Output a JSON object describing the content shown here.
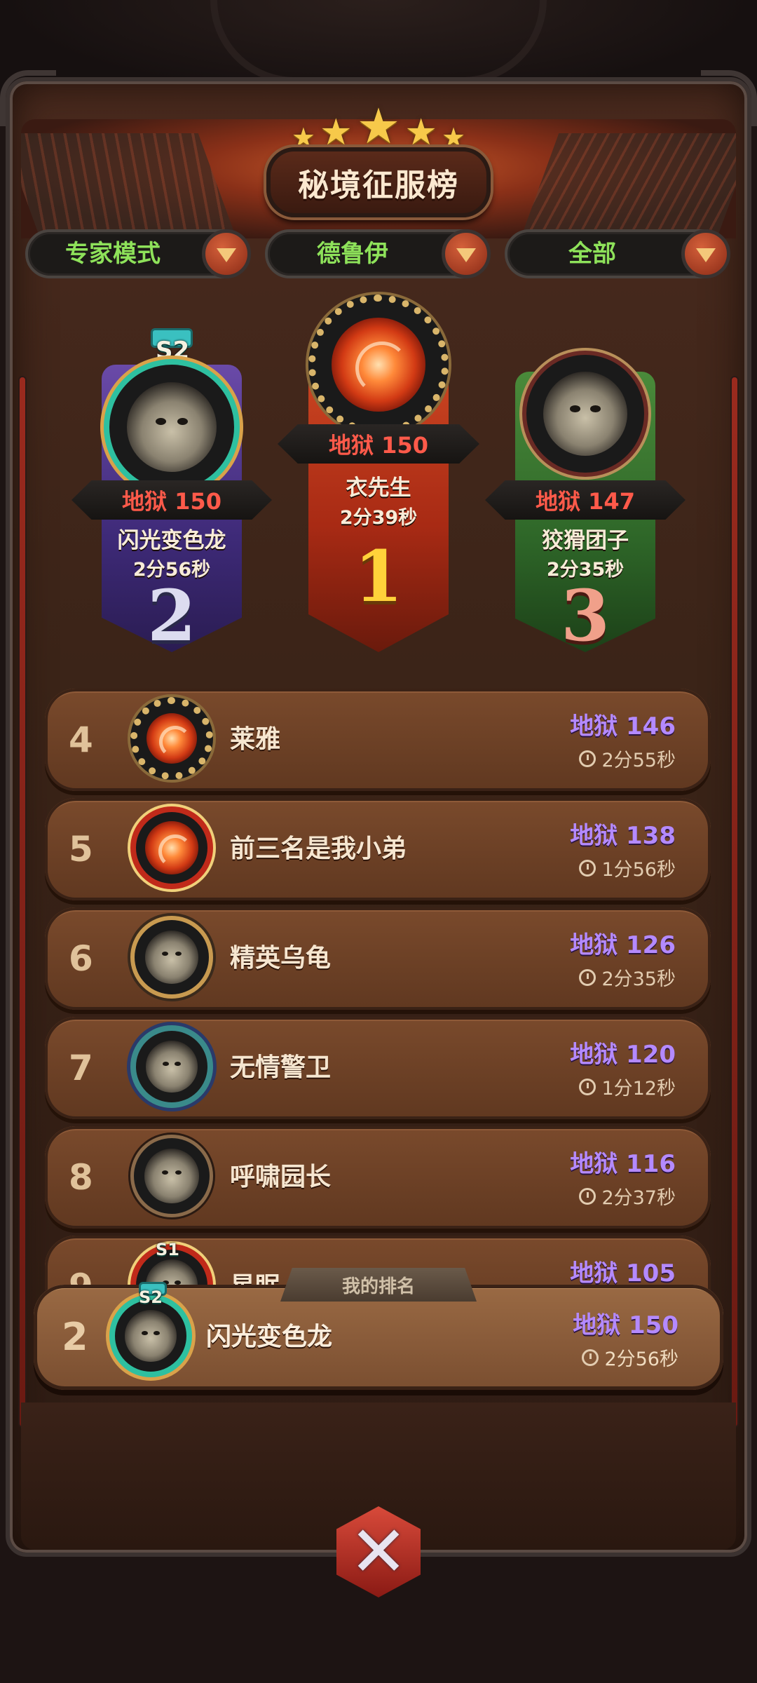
{
  "header": {
    "title": "秘境征服榜",
    "stars": 5
  },
  "filters": [
    {
      "label": "专家模式",
      "icon": "dropdown-arrow-icon"
    },
    {
      "label": "德鲁伊",
      "icon": "dropdown-arrow-icon"
    },
    {
      "label": "全部",
      "icon": "dropdown-arrow-icon"
    }
  ],
  "podium": {
    "first": {
      "rank": "1",
      "score": "地狱 150",
      "name": "衣先生",
      "time": "2分39秒"
    },
    "second": {
      "rank": "2",
      "score": "地狱 150",
      "name": "闪光变色龙",
      "time": "2分56秒",
      "season": "S2"
    },
    "third": {
      "rank": "3",
      "score": "地狱 147",
      "name": "狡猾团子",
      "time": "2分35秒"
    }
  },
  "rows": [
    {
      "rank": "4",
      "name": "莱雅",
      "score": "地狱 146",
      "time": "2分55秒"
    },
    {
      "rank": "5",
      "name": "前三名是我小弟",
      "score": "地狱 138",
      "time": "1分56秒"
    },
    {
      "rank": "6",
      "name": "精英乌龟",
      "score": "地狱 126",
      "time": "2分35秒"
    },
    {
      "rank": "7",
      "name": "无情警卫",
      "score": "地狱 120",
      "time": "1分12秒"
    },
    {
      "rank": "8",
      "name": "呼啸园长",
      "score": "地狱 116",
      "time": "2分37秒"
    },
    {
      "rank": "9",
      "name": "星眠",
      "score": "地狱 105",
      "time": "",
      "season": "S1"
    }
  ],
  "my_rank": {
    "label": "我的排名",
    "rank": "2",
    "name": "闪光变色龙",
    "score": "地狱 150",
    "time": "2分56秒",
    "season": "S2"
  },
  "colors": {
    "score_purple": "#b48aff",
    "score_red": "#ff5a4a",
    "filter_green": "#8ee25a"
  }
}
